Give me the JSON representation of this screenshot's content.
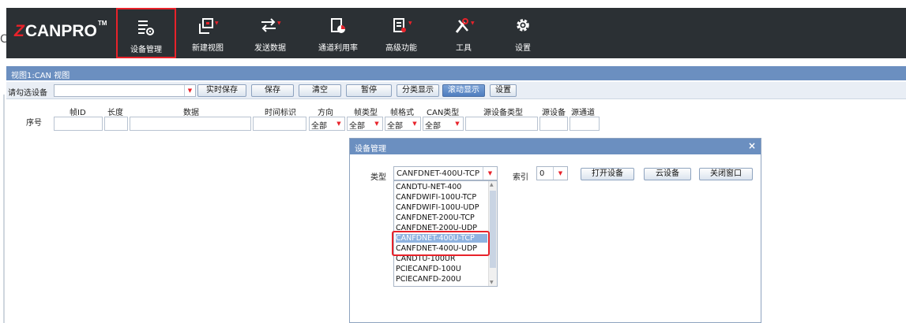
{
  "toolbar": {
    "logo_text": "CANPRO",
    "logo_mark": "Z",
    "logo_tm": "TM",
    "buttons": [
      {
        "label": "设备管理",
        "icon": "device-manage-icon",
        "active": true
      },
      {
        "label": "新建视图",
        "icon": "new-view-icon"
      },
      {
        "label": "发送数据",
        "icon": "send-data-icon"
      },
      {
        "label": "通道利用率",
        "icon": "channel-usage-icon"
      },
      {
        "label": "高级功能",
        "icon": "advanced-icon"
      },
      {
        "label": "工具",
        "icon": "tools-icon"
      },
      {
        "label": "设置",
        "icon": "settings-gear-icon"
      }
    ]
  },
  "edge_char": "C",
  "view": {
    "title": "视图1:CAN 视图"
  },
  "device_row": {
    "label": "请勾选设备",
    "buttons": {
      "realtime_save": "实时保存",
      "save": "保存",
      "clear": "清空",
      "pause": "暂停",
      "classify": "分类显示",
      "scroll": "滚动显示",
      "settings": "设置"
    }
  },
  "columns": {
    "seq": "序号",
    "frame_id": "帧ID",
    "length": "长度",
    "data": "数据",
    "timestamp": "时间标识",
    "direction": "方向",
    "frame_type": "帧类型",
    "frame_format": "帧格式",
    "can_type": "CAN类型",
    "src_dev_type": "源设备类型",
    "src_dev": "源设备",
    "src_channel": "源通道"
  },
  "filters": {
    "direction": "全部",
    "frame_type": "全部",
    "frame_format": "全部",
    "can_type": "全部"
  },
  "dialog": {
    "title": "设备管理",
    "close": "×",
    "type_label": "类型",
    "type_value": "CANFDNET-400U-TCP",
    "index_label": "索引",
    "index_value": "0",
    "open_button": "打开设备",
    "cloud_button": "云设备",
    "close_button": "关闭窗口",
    "options": [
      "CANDTU-NET-400",
      "CANFDWIFI-100U-TCP",
      "CANFDWIFI-100U-UDP",
      "CANFDNET-200U-TCP",
      "CANFDNET-200U-UDP",
      "CANFDNET-400U-TCP",
      "CANFDNET-400U-UDP",
      "CANDTU-100UR",
      "PCIECANFD-100U",
      "PCIECANFD-200U"
    ],
    "selected_index": 5
  },
  "colors": {
    "toolbar_bg": "#2b3034",
    "accent_red": "#e8222a",
    "title_blue": "#6b8fc0",
    "selected_blue": "#8fb3e0"
  }
}
